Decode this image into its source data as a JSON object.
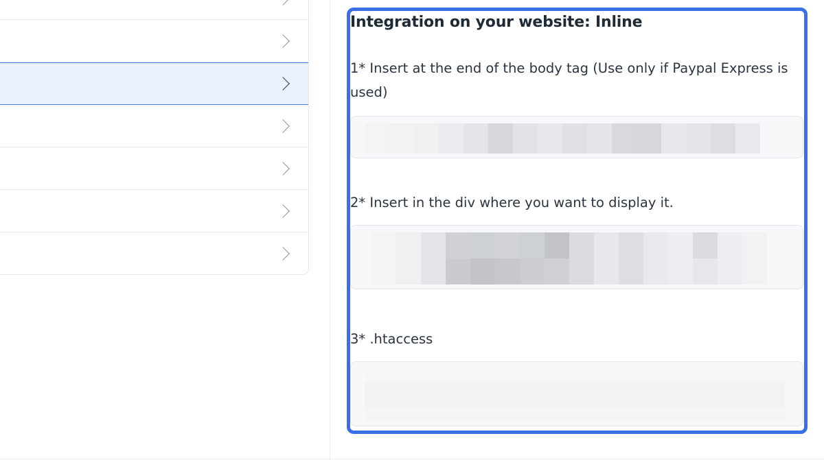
{
  "panel": {
    "title": "Integration on your website: Inline",
    "steps": [
      {
        "label": "1* Insert at the end of the body tag (Use only if Paypal Express is used)"
      },
      {
        "label": "2* Insert in the div where you want to display it."
      },
      {
        "label": "3* .htaccess"
      }
    ]
  },
  "colors": {
    "highlight_border": "#3b6fe6",
    "active_item_bg": "#eaf1ff",
    "active_item_border": "#4a7fd6"
  },
  "icons": {
    "menu_chevron": "chevron-right-icon"
  }
}
